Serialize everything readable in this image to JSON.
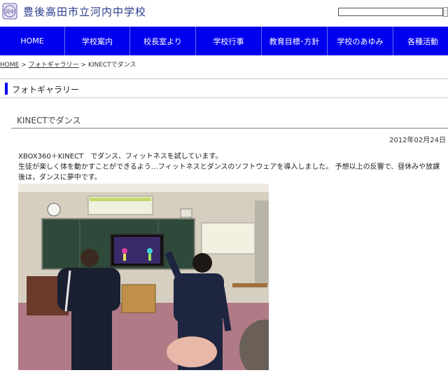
{
  "site": {
    "title": "豊後高田市立河内中学校",
    "logo_text": "河中"
  },
  "search": {
    "value": "",
    "placeholder": ""
  },
  "nav": {
    "items": [
      "HOME",
      "学校案内",
      "校長室より",
      "学校行事",
      "教育目標･方針",
      "学校のあゆみ",
      "各種活動"
    ]
  },
  "breadcrumb": {
    "home": "HOME",
    "sep1": ">",
    "gallery": "フォトギャラリー",
    "sep2": ">",
    "current": "KINECTでダンス"
  },
  "section": {
    "title": "フォトギャラリー"
  },
  "post": {
    "title": "KINECTでダンス",
    "date": "2012年02月24日",
    "line1": "XBOX360＋KINECT　でダンス、フィットネスを試しています。",
    "line2": "生徒が楽しく体を動かすことができるよう…フィットネスとダンスのソフトウェアを導入しました。 予想以上の反響で、昼休みや放課後は，ダンスに夢中です。"
  },
  "colors": {
    "nav_bg": "#0000ee",
    "accent_bar": "#0000ee",
    "title_color": "#2a3a8a"
  },
  "icons": {
    "logo": "school-emblem-icon"
  }
}
